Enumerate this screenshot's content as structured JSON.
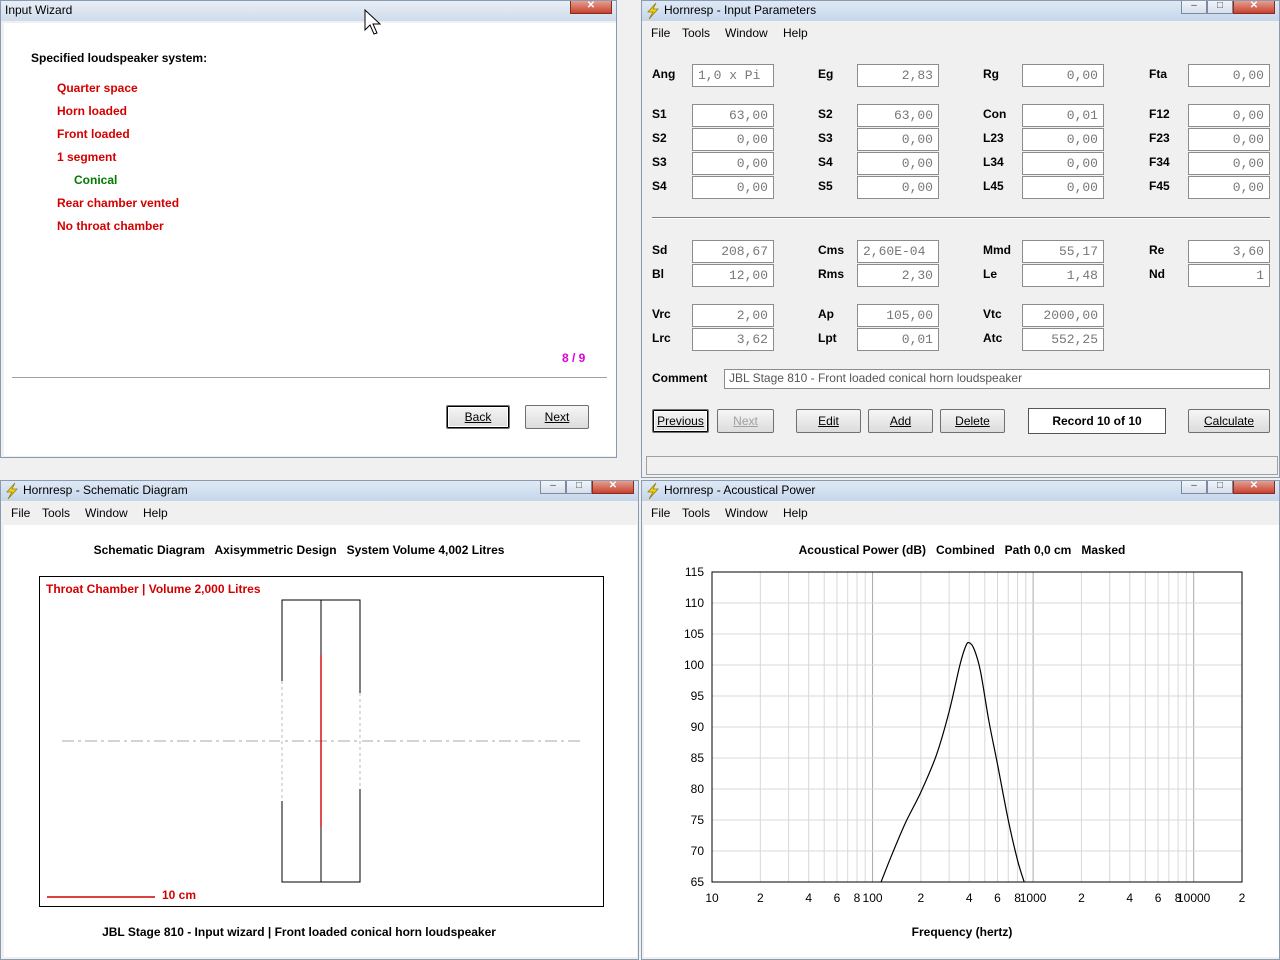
{
  "wizard": {
    "title": "Input Wizard",
    "heading": "Specified loudspeaker system:",
    "items": [
      {
        "text": "Quarter space",
        "color": "#d40000"
      },
      {
        "text": "Horn loaded",
        "color": "#d40000"
      },
      {
        "text": "Front loaded",
        "color": "#d40000"
      },
      {
        "text": "1 segment",
        "color": "#d40000"
      },
      {
        "text": "Conical",
        "color": "#007a00"
      },
      {
        "text": "Rear chamber vented",
        "color": "#d40000"
      },
      {
        "text": "No throat chamber",
        "color": "#d40000"
      }
    ],
    "page": "8 / 9",
    "back": "Back",
    "next": "Next"
  },
  "input": {
    "title": "Hornresp - Input Parameters",
    "menu": [
      "File",
      "Tools",
      "Window",
      "Help"
    ],
    "row1": [
      {
        "label": "Ang",
        "value": "1,0 x Pi"
      },
      {
        "label": "Eg",
        "value": "2,83"
      },
      {
        "label": "Rg",
        "value": "0,00"
      },
      {
        "label": "Fta",
        "value": "0,00"
      }
    ],
    "grid": [
      [
        {
          "label": "S1",
          "value": "63,00"
        },
        {
          "label": "S2",
          "value": "63,00"
        },
        {
          "label": "Con",
          "value": "0,01"
        },
        {
          "label": "F12",
          "value": "0,00"
        }
      ],
      [
        {
          "label": "S2",
          "value": "0,00"
        },
        {
          "label": "S3",
          "value": "0,00"
        },
        {
          "label": "L23",
          "value": "0,00"
        },
        {
          "label": "F23",
          "value": "0,00"
        }
      ],
      [
        {
          "label": "S3",
          "value": "0,00"
        },
        {
          "label": "S4",
          "value": "0,00"
        },
        {
          "label": "L34",
          "value": "0,00"
        },
        {
          "label": "F34",
          "value": "0,00"
        }
      ],
      [
        {
          "label": "S4",
          "value": "0,00"
        },
        {
          "label": "S5",
          "value": "0,00"
        },
        {
          "label": "L45",
          "value": "0,00"
        },
        {
          "label": "F45",
          "value": "0,00"
        }
      ]
    ],
    "driver": [
      [
        {
          "label": "Sd",
          "value": "208,67"
        },
        {
          "label": "Cms",
          "value": "2,60E-04"
        },
        {
          "label": "Mmd",
          "value": "55,17"
        },
        {
          "label": "Re",
          "value": "3,60"
        }
      ],
      [
        {
          "label": "Bl",
          "value": "12,00"
        },
        {
          "label": "Rms",
          "value": "2,30"
        },
        {
          "label": "Le",
          "value": "1,48"
        },
        {
          "label": "Nd",
          "value": "1"
        }
      ]
    ],
    "chamber": [
      [
        {
          "label": "Vrc",
          "value": "2,00"
        },
        {
          "label": "Ap",
          "value": "105,00"
        },
        {
          "label": "Vtc",
          "value": "2000,00"
        }
      ],
      [
        {
          "label": "Lrc",
          "value": "3,62"
        },
        {
          "label": "Lpt",
          "value": "0,01"
        },
        {
          "label": "Atc",
          "value": "552,25"
        }
      ]
    ],
    "comment_label": "Comment",
    "comment": "JBL Stage 810 - Front loaded conical horn loudspeaker",
    "buttons": {
      "previous": "Previous",
      "next": "Next",
      "edit": "Edit",
      "add": "Add",
      "delete": "Delete",
      "record": "Record 10 of 10",
      "calculate": "Calculate"
    }
  },
  "schematic": {
    "title": "Hornresp - Schematic Diagram",
    "menu": [
      "File",
      "Tools",
      "Window",
      "Help"
    ],
    "header": "Schematic Diagram   Axisymmetric Design   System Volume 4,002 Litres",
    "chamber_label": "Throat Chamber | Volume 2,000 Litres",
    "scale_label": "10 cm",
    "footer": "JBL Stage 810 - Input wizard | Front loaded conical horn loudspeaker",
    "accent_color": "#d40000"
  },
  "power": {
    "title": "Hornresp - Acoustical Power",
    "menu": [
      "File",
      "Tools",
      "Window",
      "Help"
    ],
    "header": "Acoustical Power (dB)   Combined   Path 0,0 cm   Masked",
    "xlabel": "Frequency (hertz)"
  },
  "chart_data": {
    "type": "line",
    "title": "Acoustical Power (dB)   Combined   Path 0,0 cm   Masked",
    "xlabel": "Frequency (hertz)",
    "ylabel": "",
    "xscale": "log",
    "xlim": [
      10,
      20000
    ],
    "ylim": [
      65,
      115
    ],
    "grid": true,
    "yticks": [
      "115",
      "110",
      "105",
      "100",
      "95",
      "90",
      "85",
      "80",
      "75",
      "70",
      "65"
    ],
    "xticks": [
      {
        "v": 10,
        "t": "10"
      },
      {
        "v": 20,
        "t": "2"
      },
      {
        "v": 40,
        "t": "4"
      },
      {
        "v": 60,
        "t": "6"
      },
      {
        "v": 80,
        "t": "8"
      },
      {
        "v": 100,
        "t": "100"
      },
      {
        "v": 200,
        "t": "2"
      },
      {
        "v": 400,
        "t": "4"
      },
      {
        "v": 600,
        "t": "6"
      },
      {
        "v": 800,
        "t": "8"
      },
      {
        "v": 1000,
        "t": "1000"
      },
      {
        "v": 2000,
        "t": "2"
      },
      {
        "v": 4000,
        "t": "4"
      },
      {
        "v": 6000,
        "t": "6"
      },
      {
        "v": 8000,
        "t": "8"
      },
      {
        "v": 10000,
        "t": "10000"
      },
      {
        "v": 20000,
        "t": "2"
      }
    ],
    "series": [
      {
        "x": [
          113,
          130,
          160,
          200,
          250,
          300,
          350,
          380,
          400,
          430,
          470,
          530,
          600,
          700,
          800,
          880
        ],
        "y": [
          65,
          69,
          74.5,
          79.5,
          85.5,
          92.5,
          100,
          103,
          103.6,
          102.5,
          99,
          91,
          84,
          75,
          68.5,
          65
        ]
      }
    ]
  }
}
